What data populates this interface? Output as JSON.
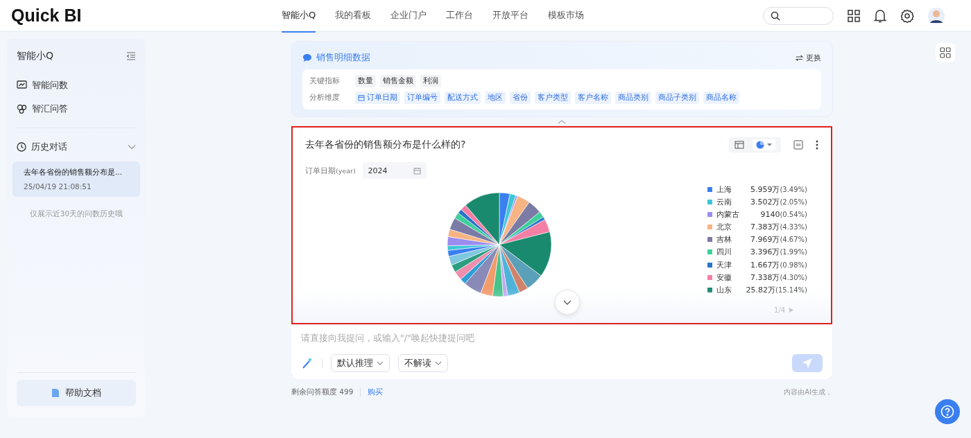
{
  "header": {
    "logo": "Quick BI",
    "nav": [
      {
        "label": "智能小Q",
        "selected": true
      },
      {
        "label": "我的看板",
        "selected": false
      },
      {
        "label": "企业门户",
        "selected": false
      },
      {
        "label": "工作台",
        "selected": false
      },
      {
        "label": "开放平台",
        "selected": false
      },
      {
        "label": "模板市场",
        "selected": false
      }
    ]
  },
  "sidebar": {
    "title": "智能小Q",
    "items": [
      {
        "label": "智能问数"
      },
      {
        "label": "智汇问答"
      }
    ],
    "history": {
      "title": "历史对话",
      "expanded": true,
      "items": [
        {
          "title": "去年各省份的销售额分布是...",
          "time": "25/04/19 21:08:51",
          "selected": true
        }
      ],
      "note": "仅展示近30天的问数历史哦"
    },
    "help": "帮助文档"
  },
  "dataset": {
    "title": "销售明细数据",
    "switch": "更换",
    "metrics_label": "关键指标",
    "metrics": [
      "数量",
      "销售金额",
      "利润"
    ],
    "dims_label": "分析维度",
    "dims": [
      {
        "label": "订单日期",
        "date": true
      },
      {
        "label": "订单编号",
        "date": false
      },
      {
        "label": "配送方式",
        "date": false
      },
      {
        "label": "地区",
        "date": false
      },
      {
        "label": "省份",
        "date": false
      },
      {
        "label": "客户类型",
        "date": false
      },
      {
        "label": "客户名称",
        "date": false
      },
      {
        "label": "商品类别",
        "date": false
      },
      {
        "label": "商品子类别",
        "date": false
      },
      {
        "label": "商品名称",
        "date": false
      }
    ]
  },
  "answer": {
    "highlighted": true,
    "question": "去年各省份的销售额分布是什么样的?",
    "filter_label": "订单日期",
    "filter_unit": "(year)",
    "filter_value": "2024",
    "legend": [
      {
        "name": "上海",
        "value": "5.959万",
        "share": "(3.49%)",
        "color": "#3a7ff0"
      },
      {
        "name": "云南",
        "value": "3.502万",
        "share": "(2.05%)",
        "color": "#3ec6d8"
      },
      {
        "name": "内蒙古",
        "value": "9140",
        "share": "(0.54%)",
        "color": "#9b8cf0"
      },
      {
        "name": "北京",
        "value": "7.383万",
        "share": "(4.33%)",
        "color": "#f7b483"
      },
      {
        "name": "吉林",
        "value": "7.969万",
        "share": "(4.67%)",
        "color": "#7b7ba6"
      },
      {
        "name": "四川",
        "value": "3.396万",
        "share": "(1.99%)",
        "color": "#3fcf9a"
      },
      {
        "name": "天津",
        "value": "1.667万",
        "share": "(0.98%)",
        "color": "#2774c9"
      },
      {
        "name": "安徽",
        "value": "7.338万",
        "share": "(4.30%)",
        "color": "#f47fa4"
      },
      {
        "name": "山东",
        "value": "25.82万",
        "share": "(15.14%)",
        "color": "#1a8a6e"
      }
    ],
    "pager": "1/4"
  },
  "input": {
    "placeholder": "请直接向我提问，或输入\"/\"唤起快捷提问吧",
    "mode": "默认推理",
    "explain": "不解读"
  },
  "footer": {
    "quota": "剩余问答额度 499",
    "buy": "购买",
    "disclaimer": "内容由AI生成，"
  }
}
